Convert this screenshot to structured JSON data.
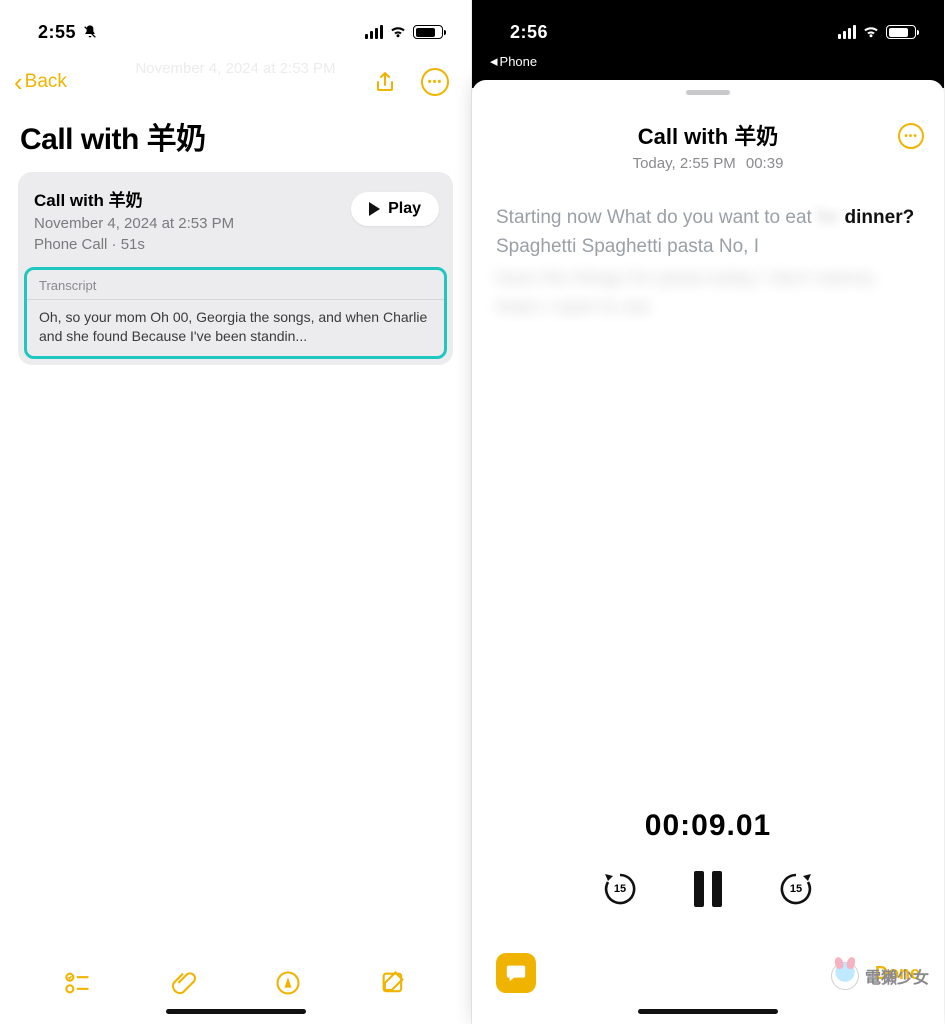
{
  "left": {
    "status": {
      "time": "2:55"
    },
    "nav": {
      "back": "Back"
    },
    "ghost_title": "November 4, 2024 at 2:53 PM",
    "title": "Call with 羊奶",
    "card": {
      "title": "Call with 羊奶",
      "datetime": "November 4, 2024 at 2:53 PM",
      "meta": "Phone Call · 51s",
      "play": "Play",
      "transcript_label": "Transcript",
      "transcript_preview": "Oh, so your mom Oh 00, Georgia the songs, and when Charlie and she found  Because I've been standin..."
    },
    "toolbar": {
      "checklist": "checklist",
      "attach": "attach",
      "markup": "markup",
      "compose": "compose"
    }
  },
  "right": {
    "status": {
      "time": "2:56"
    },
    "breadcrumb": "Phone",
    "sheet": {
      "title": "Call with 羊奶",
      "subtitle": "Today, 2:55 PM",
      "duration": "00:39",
      "transcript": {
        "pre": "Starting now What do you want to eat ",
        "blur1": "for",
        "current": "dinner?",
        "post": " Spaghetti Spaghetti pasta No, I",
        "blurred_rest": "have the things for pasta today I don't wanna listen I want to eat"
      }
    },
    "player": {
      "time": "00:09.01",
      "seek": "15"
    },
    "done": "Done"
  },
  "watermark": "電獺少女"
}
